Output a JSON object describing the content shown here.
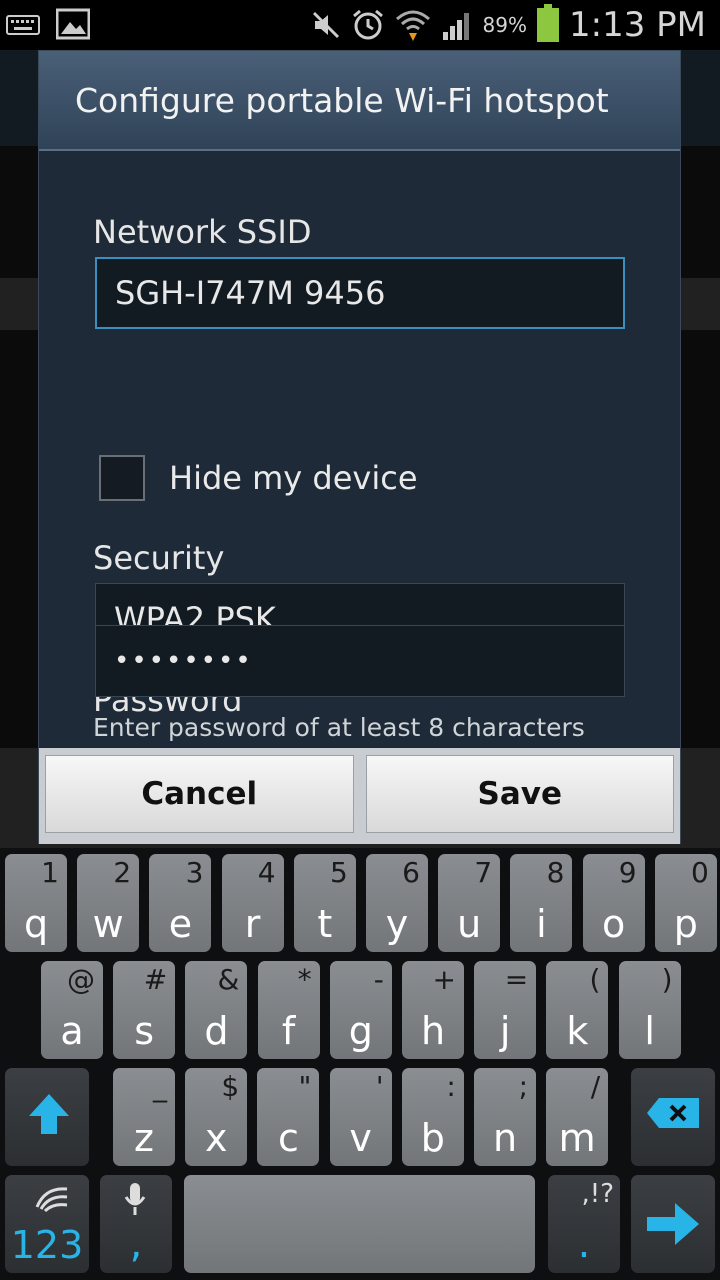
{
  "status_bar": {
    "battery_percent": "89%",
    "time": "1:13 PM",
    "left_icons": [
      "keyboard-icon",
      "picture-icon"
    ],
    "right_icons": [
      "mute-icon",
      "alarm-icon",
      "wifi-icon",
      "signal-icon",
      "battery-icon"
    ]
  },
  "dialog": {
    "title": "Configure portable Wi-Fi hotspot",
    "ssid_label": "Network SSID",
    "ssid_value": "SGH-I747M 9456",
    "hide_device_label": "Hide my device",
    "hide_device_checked": false,
    "security_label": "Security",
    "security_value": "WPA2 PSK",
    "password_label": "Password",
    "password_value": "••••••••",
    "password_hint": "Enter password of at least 8 characters",
    "cancel_label": "Cancel",
    "save_label": "Save"
  },
  "keyboard": {
    "row1": [
      {
        "main": "q",
        "sec": "1"
      },
      {
        "main": "w",
        "sec": "2"
      },
      {
        "main": "e",
        "sec": "3"
      },
      {
        "main": "r",
        "sec": "4"
      },
      {
        "main": "t",
        "sec": "5"
      },
      {
        "main": "y",
        "sec": "6"
      },
      {
        "main": "u",
        "sec": "7"
      },
      {
        "main": "i",
        "sec": "8"
      },
      {
        "main": "o",
        "sec": "9"
      },
      {
        "main": "p",
        "sec": "0"
      }
    ],
    "row2": [
      {
        "main": "a",
        "sec": "@"
      },
      {
        "main": "s",
        "sec": "#"
      },
      {
        "main": "d",
        "sec": "&"
      },
      {
        "main": "f",
        "sec": "*"
      },
      {
        "main": "g",
        "sec": "-"
      },
      {
        "main": "h",
        "sec": "+"
      },
      {
        "main": "j",
        "sec": "="
      },
      {
        "main": "k",
        "sec": "("
      },
      {
        "main": "l",
        "sec": ")"
      }
    ],
    "row3": [
      {
        "main": "z",
        "sec": "_"
      },
      {
        "main": "x",
        "sec": "$"
      },
      {
        "main": "c",
        "sec": "\""
      },
      {
        "main": "v",
        "sec": "'"
      },
      {
        "main": "b",
        "sec": ":"
      },
      {
        "main": "n",
        "sec": ";"
      },
      {
        "main": "m",
        "sec": "/"
      }
    ],
    "sym_label": "123",
    "comma_label": ",",
    "period_label": ".",
    "punct_label": ",!?",
    "accent_color": "#29b4e8"
  }
}
